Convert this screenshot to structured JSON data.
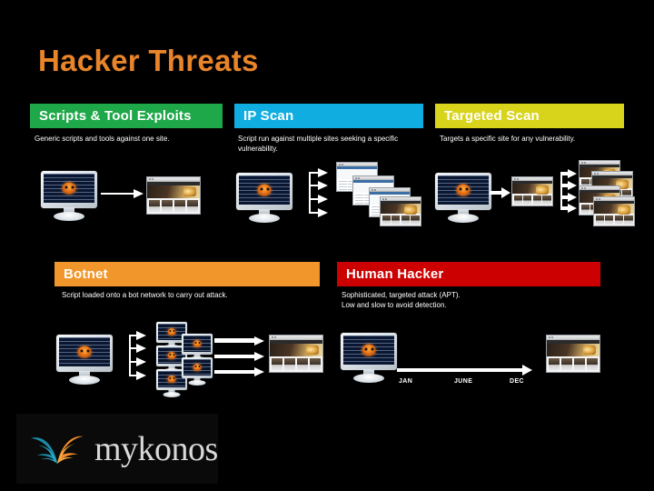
{
  "slide": {
    "title": "Hacker Threats",
    "background_color": "#000000",
    "title_color": "#e8842a"
  },
  "categories": [
    {
      "id": "scripts",
      "label": "Scripts & Tool Exploits",
      "bar_color": "#1fa84a",
      "description": "Generic scripts and tools against one site."
    },
    {
      "id": "ipscan",
      "label": "IP Scan",
      "bar_color": "#10aee0",
      "description": "Script run against multiple sites seeking a specific vulnerability."
    },
    {
      "id": "targeted",
      "label": "Targeted Scan",
      "bar_color": "#d8d41c",
      "description": "Targets a specific site for any vulnerability."
    },
    {
      "id": "botnet",
      "label": "Botnet",
      "bar_color": "#f0962a",
      "description": "Script loaded onto a bot network to carry out attack."
    },
    {
      "id": "human",
      "label": "Human Hacker",
      "bar_color": "#cc0000",
      "description": "Sophisticated, targeted attack (APT).\nLow and slow to avoid detection."
    }
  ],
  "timeline": {
    "labels": [
      "JAN",
      "JUNE",
      "DEC"
    ]
  },
  "logo": {
    "wordmark": "mykonos",
    "mark_color_left": "#1b8ba6",
    "mark_color_right": "#ef8b2c"
  }
}
